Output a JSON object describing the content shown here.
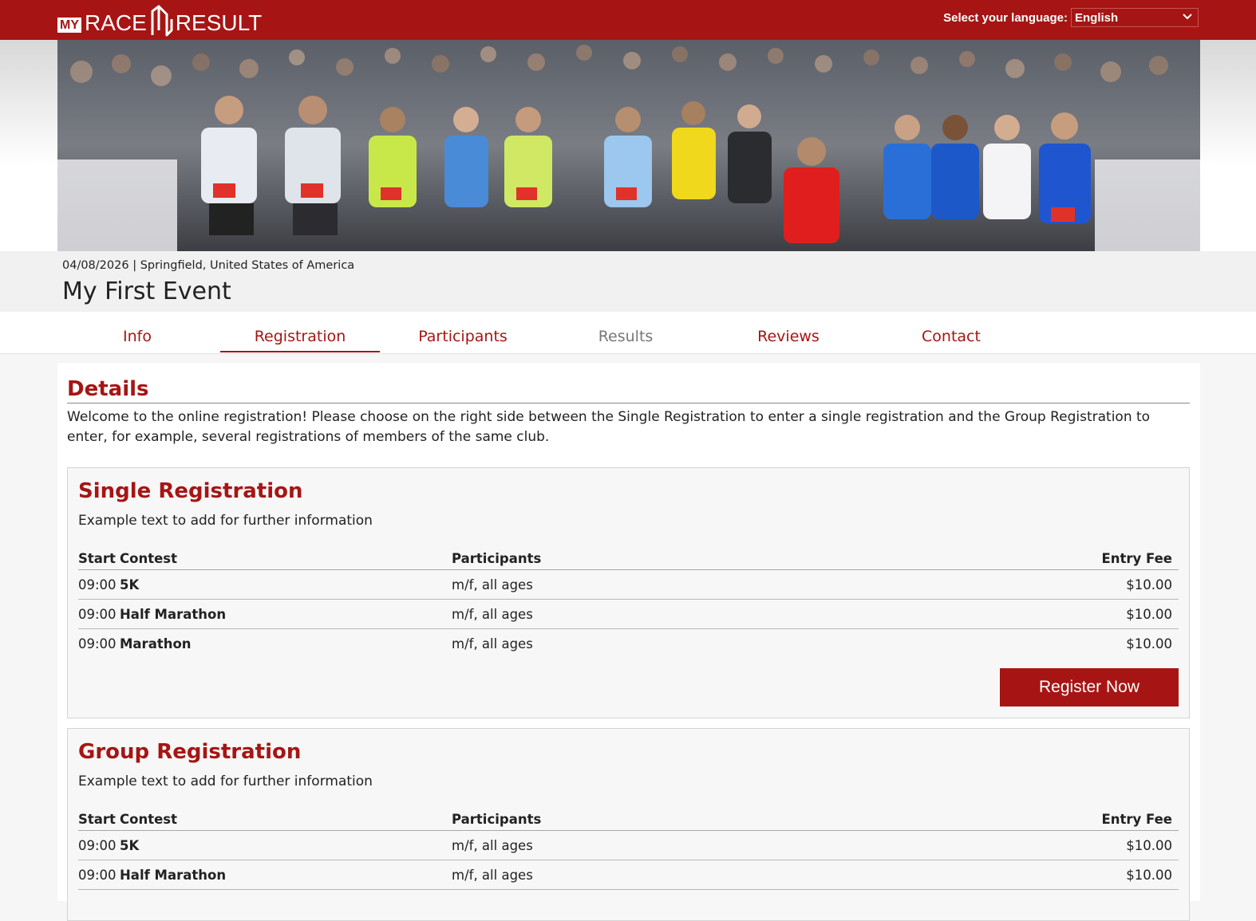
{
  "header": {
    "logo": {
      "my": "MY",
      "race": "RACE",
      "result": "RESULT"
    },
    "language_label": "Select your language:",
    "language_value": "English"
  },
  "event": {
    "date": "04/08/2026",
    "separator": "|",
    "location": "Springfield, United States of America",
    "title": "My First Event"
  },
  "tabs": [
    {
      "label": "Info",
      "state": "normal"
    },
    {
      "label": "Registration",
      "state": "active"
    },
    {
      "label": "Participants",
      "state": "normal"
    },
    {
      "label": "Results",
      "state": "disabled"
    },
    {
      "label": "Reviews",
      "state": "normal"
    },
    {
      "label": "Contact",
      "state": "normal"
    }
  ],
  "details": {
    "title": "Details",
    "intro": "Welcome to the online registration! Please choose on the right side between the Single Registration to enter a single registration and the Group Registration to enter, for example, several registrations of members of the same club."
  },
  "columns": {
    "start": "Start",
    "contest": "Contest",
    "participants": "Participants",
    "fee": "Entry Fee"
  },
  "single": {
    "title": "Single Registration",
    "desc": "Example text to add for further information",
    "rows": [
      {
        "start": "09:00",
        "contest": "5K",
        "participants": "m/f, all ages",
        "fee": "$10.00"
      },
      {
        "start": "09:00",
        "contest": "Half Marathon",
        "participants": "m/f, all ages",
        "fee": "$10.00"
      },
      {
        "start": "09:00",
        "contest": "Marathon",
        "participants": "m/f, all ages",
        "fee": "$10.00"
      }
    ],
    "button": "Register Now"
  },
  "group": {
    "title": "Group Registration",
    "desc": "Example text to add for further information",
    "rows": [
      {
        "start": "09:00",
        "contest": "5K",
        "participants": "m/f, all ages",
        "fee": "$10.00"
      },
      {
        "start": "09:00",
        "contest": "Half Marathon",
        "participants": "m/f, all ages",
        "fee": "$10.00"
      }
    ]
  },
  "colors": {
    "brand": "#a61514",
    "text": "#222222",
    "disabled": "#777777"
  }
}
